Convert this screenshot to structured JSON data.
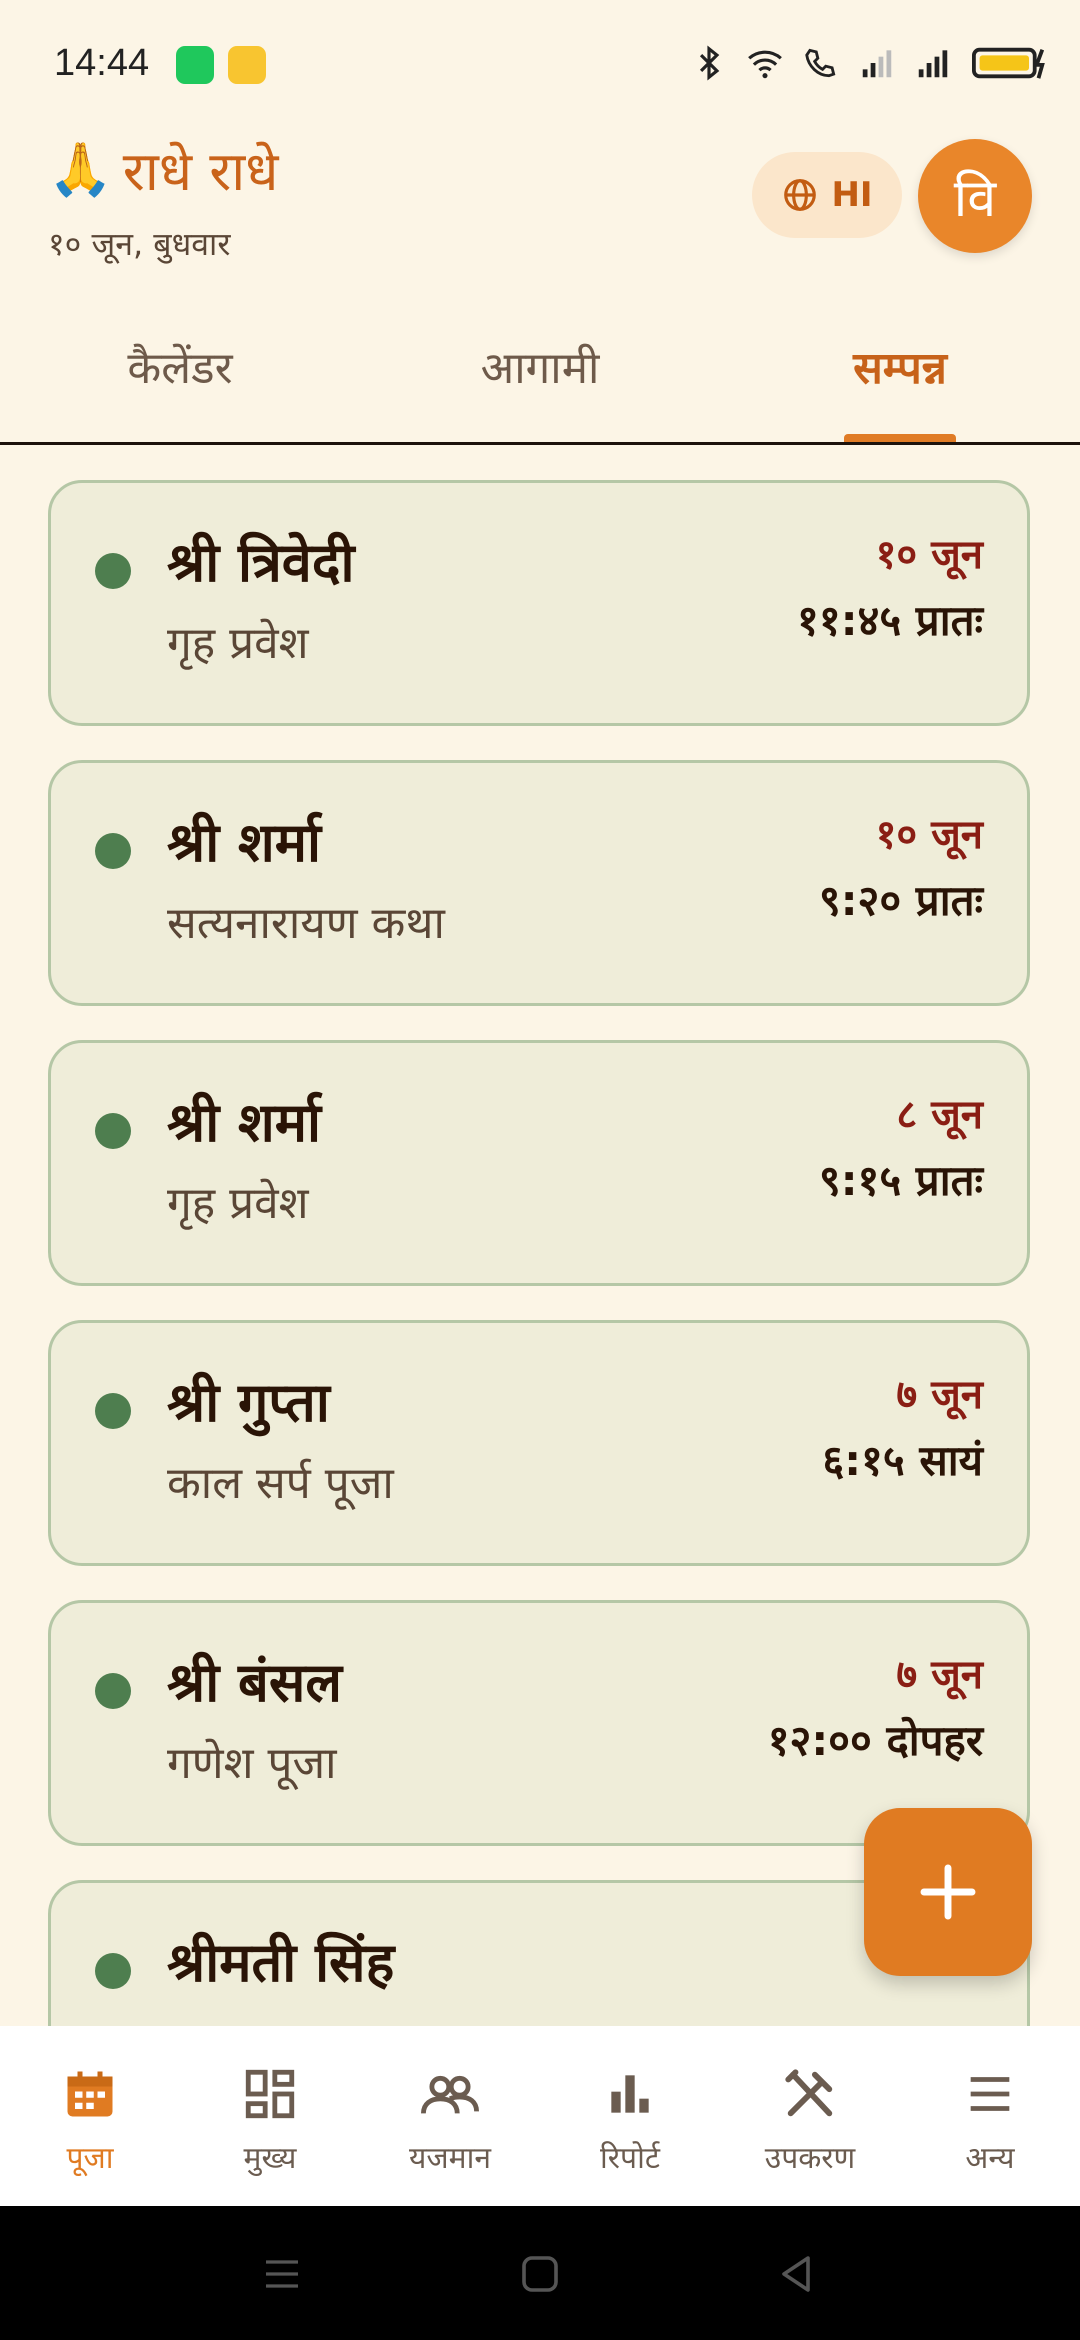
{
  "status_bar": {
    "time": "14:44"
  },
  "header": {
    "greeting_emoji": "🙏",
    "greeting": "राधे राधे",
    "date": "१० जून, बुधवार",
    "language_label": "HI",
    "avatar_letter": "वि"
  },
  "tabs": [
    {
      "label": "कैलेंडर"
    },
    {
      "label": "आगामी"
    },
    {
      "label": "सम्पन्न"
    }
  ],
  "bookings": [
    {
      "name": "श्री त्रिवेदी",
      "puja": "गृह प्रवेश",
      "date": "१० जून",
      "time": "११:४५ प्रातः"
    },
    {
      "name": "श्री शर्मा",
      "puja": "सत्यनारायण कथा",
      "date": "१० जून",
      "time": "९:२० प्रातः"
    },
    {
      "name": "श्री शर्मा",
      "puja": "गृह प्रवेश",
      "date": "८ जून",
      "time": "९:१५ प्रातः"
    },
    {
      "name": "श्री गुप्ता",
      "puja": "काल सर्प पूजा",
      "date": "७ जून",
      "time": "६:१५ सायं"
    },
    {
      "name": "श्री बंसल",
      "puja": "गणेश पूजा",
      "date": "७ जून",
      "time": "१२:०० दोपहर"
    },
    {
      "name": "श्रीमती सिंह",
      "puja": "",
      "date": "",
      "time": ""
    }
  ],
  "bottom_nav": [
    {
      "label": "पूजा",
      "icon": "calendar-icon"
    },
    {
      "label": "मुख्य",
      "icon": "dashboard-icon"
    },
    {
      "label": "यजमान",
      "icon": "people-icon"
    },
    {
      "label": "रिपोर्ट",
      "icon": "bar-chart-icon"
    },
    {
      "label": "उपकरण",
      "icon": "tools-icon"
    },
    {
      "label": "अन्य",
      "icon": "menu-icon"
    }
  ],
  "colors": {
    "accent": "#E07B22",
    "background": "#FCF5E6",
    "card": "#EFEDD9",
    "status_dot": "#4E7E4F",
    "date_text": "#8A1E14"
  }
}
